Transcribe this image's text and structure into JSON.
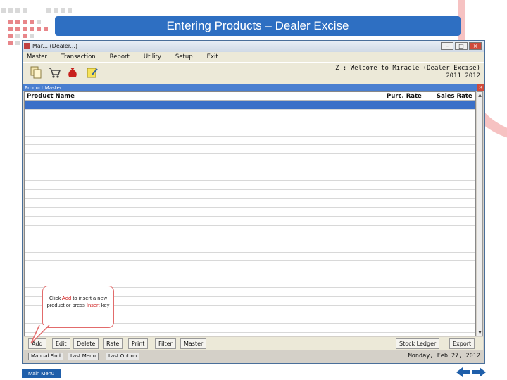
{
  "slide": {
    "title": "Entering Products – Dealer Excise",
    "main_menu": "Main Menu",
    "callout": {
      "pre": "Click ",
      "add": "Add",
      "mid": " to insert a new product or press ",
      "insert": "Insert",
      "post": " key"
    }
  },
  "window": {
    "title": "Mar... (Dealer...)",
    "menu": [
      "Master",
      "Transaction",
      "Report",
      "Utility",
      "Setup",
      "Exit"
    ],
    "welcome": "Z : Welcome to Miracle (Dealer Excise)",
    "year": "2011   2012",
    "toolbar_icons": [
      "document-copy-icon",
      "cart-icon",
      "money-bag-icon",
      "note-edit-icon"
    ]
  },
  "product_master": {
    "title": "Product Master",
    "columns": [
      "Product Name",
      "Purc. Rate",
      "Sales Rate"
    ],
    "row_count": 26
  },
  "buttons_left": [
    "Add",
    "Edit",
    "Delete",
    "Rate",
    "Print",
    "Filter",
    "Master"
  ],
  "buttons_right": [
    "Stock Ledger",
    "Export"
  ],
  "status": {
    "tabs": [
      "Manual Find",
      "Last Menu",
      "Last Option"
    ],
    "date": "Monday, Feb 27, 2012"
  },
  "colors": {
    "accent": "#2e6fc2",
    "selection": "#3a6fc8",
    "callout_border": "#e26b6b"
  }
}
